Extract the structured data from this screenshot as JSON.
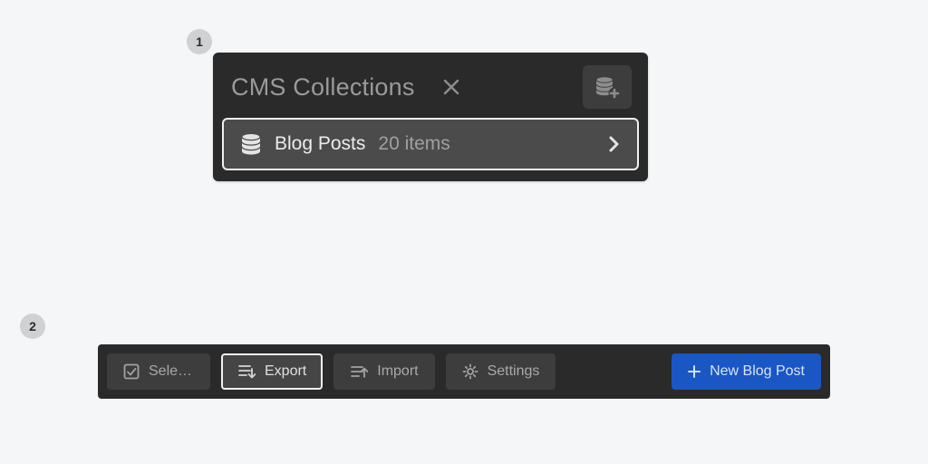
{
  "steps": {
    "one": "1",
    "two": "2"
  },
  "panel": {
    "title": "CMS Collections",
    "collection": {
      "name": "Blog Posts",
      "count_label": "20 items"
    }
  },
  "toolbar": {
    "select_label": "Select...",
    "export_label": "Export",
    "import_label": "Import",
    "settings_label": "Settings",
    "new_label": "New Blog Post"
  }
}
